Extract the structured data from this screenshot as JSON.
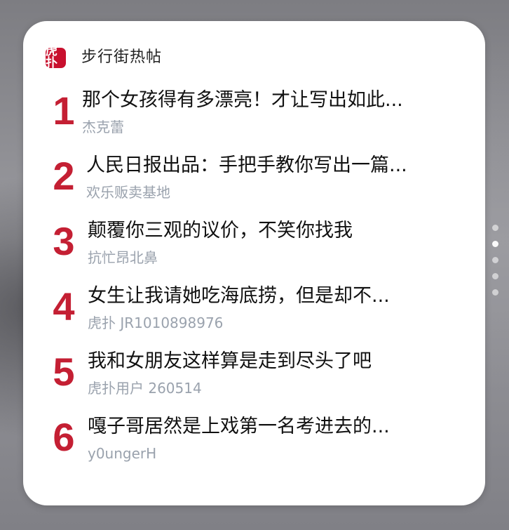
{
  "widget": {
    "app_icon_glyph": "虎扑",
    "app_name": "步行街热帖",
    "accent_color": "#c41f33"
  },
  "posts": [
    {
      "rank": "1",
      "title": "那个女孩得有多漂亮！才让写出如此...",
      "author": "杰克蕾"
    },
    {
      "rank": "2",
      "title": "人民日报出品：手把手教你写出一篇...",
      "author": "欢乐贩卖基地"
    },
    {
      "rank": "3",
      "title": "颠覆你三观的议价，不笑你找我",
      "author": "抗忙昂北鼻"
    },
    {
      "rank": "4",
      "title": "女生让我请她吃海底捞，但是却不...",
      "author": "虎扑 JR1010898976"
    },
    {
      "rank": "5",
      "title": "我和女朋友这样算是走到尽头了吧",
      "author": "虎扑用户 260514"
    },
    {
      "rank": "6",
      "title": "嘎子哥居然是上戏第一名考进去的...",
      "author": "y0ungerH"
    }
  ],
  "page_indicator": {
    "pages": 5,
    "current": 2
  }
}
